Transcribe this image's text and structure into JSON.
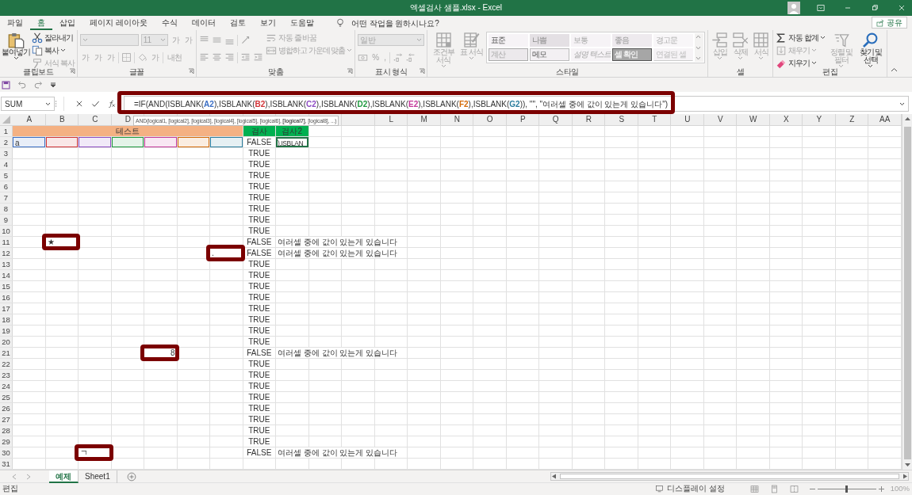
{
  "window": {
    "title": "엑셀검사 샘플.xlsx - Excel"
  },
  "menu_tabs": [
    {
      "label": "파일",
      "selected": false
    },
    {
      "label": "홈",
      "selected": true
    },
    {
      "label": "삽입",
      "selected": false
    },
    {
      "label": "페이지 레이아웃",
      "selected": false
    },
    {
      "label": "수식",
      "selected": false
    },
    {
      "label": "데이터",
      "selected": false
    },
    {
      "label": "검토",
      "selected": false
    },
    {
      "label": "보기",
      "selected": false
    },
    {
      "label": "도움말",
      "selected": false
    }
  ],
  "tell_me": {
    "label": "어떤 작업을 원하시나요?"
  },
  "share_button": {
    "label": "공유"
  },
  "ribbon_groups": [
    {
      "label": "클립보드",
      "launcher": true,
      "columns": [
        [
          {
            "kind": "large",
            "label": "붙여넣기",
            "dropdown": true,
            "disabled": false
          }
        ],
        [
          {
            "kind": "small",
            "label": "잘라내기",
            "dropdown": false,
            "disabled": false
          },
          {
            "kind": "small",
            "label": "복사",
            "dropdown": true,
            "disabled": false
          },
          {
            "kind": "small",
            "label": "서식 복사",
            "dropdown": false,
            "disabled": true
          }
        ]
      ]
    },
    {
      "label": "글꼴",
      "launcher": true,
      "columns": [
        [
          {
            "kind": "row",
            "parts": [
              {
                "kind": "combo",
                "disabled": true
              },
              {
                "kind": "combo",
                "value": "11",
                "disabled": true
              },
              {
                "kind": "glyph",
                "text": "가",
                "disabled": true
              },
              {
                "kind": "glyph",
                "text": "가",
                "disabled": true
              }
            ]
          },
          {
            "kind": "row",
            "parts": [
              {
                "kind": "glyph",
                "text": "가",
                "disabled": true
              },
              {
                "kind": "glyph",
                "text": "가",
                "disabled": true
              },
              {
                "kind": "glyph",
                "text": "가",
                "disabled": true
              },
              {
                "kind": "sep"
              },
              {
                "kind": "icon",
                "disabled": true
              },
              {
                "kind": "sep"
              },
              {
                "kind": "icon",
                "disabled": true
              },
              {
                "kind": "glyph",
                "text": "가",
                "disabled": true
              },
              {
                "kind": "sep"
              },
              {
                "kind": "glyph",
                "text": "내천",
                "disabled": true
              }
            ]
          }
        ]
      ]
    },
    {
      "label": "맞춤",
      "launcher": true,
      "columns": [
        [
          {
            "kind": "row",
            "parts": [
              {
                "kind": "icon",
                "disabled": true
              },
              {
                "kind": "icon",
                "disabled": true
              },
              {
                "kind": "icon",
                "disabled": true
              },
              {
                "kind": "sep"
              },
              {
                "kind": "icon",
                "disabled": true
              }
            ]
          },
          {
            "kind": "row",
            "parts": [
              {
                "kind": "icon",
                "disabled": true
              },
              {
                "kind": "icon",
                "disabled": true
              },
              {
                "kind": "icon",
                "disabled": true
              },
              {
                "kind": "sep"
              },
              {
                "kind": "icon",
                "disabled": true
              },
              {
                "kind": "icon",
                "disabled": true
              }
            ]
          }
        ],
        [
          {
            "kind": "small",
            "label": "자동 줄 바꿈",
            "dropdown": false,
            "disabled": true
          },
          {
            "kind": "small",
            "label": "병합하고 가운데 맞춤",
            "dropdown": true,
            "disabled": true
          }
        ]
      ]
    },
    {
      "label": "표시 형식",
      "launcher": true,
      "columns": [
        [
          {
            "kind": "row",
            "parts": [
              {
                "kind": "combo",
                "value": "일반",
                "disabled": true
              }
            ]
          },
          {
            "kind": "row",
            "parts": [
              {
                "kind": "icon",
                "disabled": true
              },
              {
                "kind": "glyph",
                "text": "%",
                "disabled": true
              },
              {
                "kind": "glyph",
                "text": ",",
                "disabled": true
              },
              {
                "kind": "sep"
              },
              {
                "kind": "icon",
                "disabled": true
              },
              {
                "kind": "icon",
                "disabled": true
              }
            ]
          }
        ]
      ]
    },
    {
      "label": "스타일",
      "launcher": false,
      "columns": [
        [
          {
            "kind": "large",
            "label": "조건부 서식",
            "dropdown": true,
            "disabled": true
          }
        ],
        [
          {
            "kind": "large",
            "label": "표 서식",
            "dropdown": true,
            "disabled": true
          }
        ],
        [
          {
            "kind": "gallery",
            "styles": [
              {
                "label": "표준",
                "kind": "normal"
              },
              {
                "label": "나쁨",
                "kind": "bad"
              },
              {
                "label": "보통",
                "kind": "neutral"
              },
              {
                "label": "좋음",
                "kind": "good"
              },
              {
                "label": "경고문",
                "kind": "warning"
              },
              {
                "label": "계산",
                "kind": "calculation"
              },
              {
                "label": "메모",
                "kind": "note"
              },
              {
                "label": "설명 텍스트",
                "kind": "explanatory"
              },
              {
                "label": "셀 확인",
                "kind": "check"
              },
              {
                "label": "연결된 셀",
                "kind": "linked"
              }
            ]
          }
        ]
      ]
    },
    {
      "label": "셀",
      "launcher": false,
      "columns": [
        [
          {
            "kind": "large",
            "label": "삽입",
            "dropdown": true,
            "disabled": true
          }
        ],
        [
          {
            "kind": "large",
            "label": "삭제",
            "dropdown": true,
            "disabled": true
          }
        ],
        [
          {
            "kind": "large",
            "label": "서식",
            "dropdown": true,
            "disabled": true
          }
        ]
      ]
    },
    {
      "label": "편집",
      "launcher": false,
      "columns": [
        [
          {
            "kind": "small",
            "label": "자동 합계",
            "dropdown": true,
            "disabled": false
          },
          {
            "kind": "small",
            "label": "채우기",
            "dropdown": true,
            "disabled": true
          },
          {
            "kind": "small",
            "label": "지우기",
            "dropdown": true,
            "disabled": false
          }
        ],
        [
          {
            "kind": "large",
            "label": "정렬 및 필터",
            "dropdown": true,
            "disabled": true
          }
        ],
        [
          {
            "kind": "large",
            "label": "찾기 및 선택",
            "dropdown": true,
            "disabled": false
          }
        ]
      ]
    }
  ],
  "name_box": {
    "value": "SUM"
  },
  "formula": {
    "highlighted": true,
    "segments": [
      {
        "text": "=IF(AND(ISBLANK("
      },
      {
        "text": "A2",
        "color": "#3c6fc4"
      },
      {
        "text": "),ISBLANK("
      },
      {
        "text": "B2",
        "color": "#d13438"
      },
      {
        "text": "),ISBLANK("
      },
      {
        "text": "C2",
        "color": "#8e4dc3"
      },
      {
        "text": "),ISBLANK("
      },
      {
        "text": "D2",
        "color": "#1f9a3f"
      },
      {
        "text": "),ISBLANK("
      },
      {
        "text": "E2",
        "color": "#c4399a"
      },
      {
        "text": "),ISBLANK("
      },
      {
        "text": "F2",
        "color": "#d46b08"
      },
      {
        "text": "),ISBLANK("
      },
      {
        "text": "G2",
        "color": "#2c7e9e"
      },
      {
        "text": ")), \"\", \"여러셀 중에 값이 있는게 있습니다\")"
      }
    ]
  },
  "tooltip": {
    "text": "AND(logical1, [logical2], [logical3], [logical4], [logical5], [logical6], **[logical7]**, [logical8], ...)"
  },
  "columns": [
    "A",
    "B",
    "C",
    "D",
    null,
    null,
    null,
    null,
    null,
    null,
    null,
    "L",
    "M",
    "N",
    "O",
    "P",
    "Q",
    "R",
    "S",
    "T",
    "U",
    "V",
    "W",
    "X",
    "Y",
    "Z",
    "AA"
  ],
  "rows": [
    {
      "header": "1",
      "cells": [
        {
          "kind": "header",
          "text": "테스트",
          "color": "#f4b183",
          "merged": true
        },
        null,
        null,
        null,
        null,
        null,
        null,
        {
          "kind": "header",
          "text": "검사",
          "color": "#00b050"
        },
        {
          "kind": "header",
          "text": "검사2",
          "color": "#00b050"
        }
      ]
    },
    {
      "header": "2",
      "cells": [
        {
          "kind": "text",
          "text": "a",
          "color": "#3c6fc4"
        },
        {
          "kind": "text",
          "color": "#d13438"
        },
        {
          "kind": "text",
          "color": "#8e4dc3"
        },
        {
          "kind": "text",
          "color": "#1f9a3f"
        },
        {
          "kind": "text",
          "color": "#c4399a"
        },
        {
          "kind": "text",
          "color": "#d46b08"
        },
        {
          "kind": "text",
          "color": "#2c7e9e"
        },
        {
          "kind": "boolean",
          "text": "FALSE"
        },
        {
          "kind": "text",
          "text": "),ISBLAN",
          "active": true
        }
      ]
    },
    {
      "header": "3",
      "cells": [
        null,
        null,
        null,
        null,
        null,
        null,
        null,
        {
          "kind": "boolean",
          "text": "TRUE"
        }
      ]
    },
    {
      "header": "4",
      "cells": [
        null,
        null,
        null,
        null,
        null,
        null,
        null,
        {
          "kind": "boolean",
          "text": "TRUE"
        }
      ]
    },
    {
      "header": "5",
      "cells": [
        null,
        null,
        null,
        null,
        null,
        null,
        null,
        {
          "kind": "boolean",
          "text": "TRUE"
        }
      ]
    },
    {
      "header": "6",
      "cells": [
        null,
        null,
        null,
        null,
        null,
        null,
        null,
        {
          "kind": "boolean",
          "text": "TRUE"
        }
      ]
    },
    {
      "header": "7",
      "cells": [
        null,
        null,
        null,
        null,
        null,
        null,
        null,
        {
          "kind": "boolean",
          "text": "TRUE"
        }
      ]
    },
    {
      "header": "8",
      "cells": [
        null,
        null,
        null,
        null,
        null,
        null,
        null,
        {
          "kind": "boolean",
          "text": "TRUE"
        }
      ]
    },
    {
      "header": "9",
      "cells": [
        null,
        null,
        null,
        null,
        null,
        null,
        null,
        {
          "kind": "boolean",
          "text": "TRUE"
        }
      ]
    },
    {
      "header": "10",
      "cells": [
        null,
        null,
        null,
        null,
        null,
        null,
        null,
        {
          "kind": "boolean",
          "text": "TRUE"
        }
      ]
    },
    {
      "header": "11",
      "cells": [
        null,
        {
          "kind": "text",
          "text": "★",
          "highlighted": true
        },
        null,
        null,
        null,
        null,
        null,
        {
          "kind": "boolean",
          "text": "FALSE"
        },
        {
          "kind": "text",
          "text": "여러셀 중에 값이 있는게 있습니다"
        }
      ]
    },
    {
      "header": "12",
      "cells": [
        null,
        null,
        null,
        null,
        null,
        null,
        {
          "kind": "text",
          "text": ".",
          "highlighted": true
        },
        {
          "kind": "boolean",
          "text": "FALSE"
        },
        {
          "kind": "text",
          "text": "여러셀 중에 값이 있는게 있습니다"
        }
      ]
    },
    {
      "header": "13",
      "cells": [
        null,
        null,
        null,
        null,
        null,
        null,
        null,
        {
          "kind": "boolean",
          "text": "TRUE"
        }
      ]
    },
    {
      "header": "14",
      "cells": [
        null,
        null,
        null,
        null,
        null,
        null,
        null,
        {
          "kind": "boolean",
          "text": "TRUE"
        }
      ]
    },
    {
      "header": "15",
      "cells": [
        null,
        null,
        null,
        null,
        null,
        null,
        null,
        {
          "kind": "boolean",
          "text": "TRUE"
        }
      ]
    },
    {
      "header": "16",
      "cells": [
        null,
        null,
        null,
        null,
        null,
        null,
        null,
        {
          "kind": "boolean",
          "text": "TRUE"
        }
      ]
    },
    {
      "header": "17",
      "cells": [
        null,
        null,
        null,
        null,
        null,
        null,
        null,
        {
          "kind": "boolean",
          "text": "TRUE"
        }
      ]
    },
    {
      "header": "18",
      "cells": [
        null,
        null,
        null,
        null,
        null,
        null,
        null,
        {
          "kind": "boolean",
          "text": "TRUE"
        }
      ]
    },
    {
      "header": "19",
      "cells": [
        null,
        null,
        null,
        null,
        null,
        null,
        null,
        {
          "kind": "boolean",
          "text": "TRUE"
        }
      ]
    },
    {
      "header": "20",
      "cells": [
        null,
        null,
        null,
        null,
        null,
        null,
        null,
        {
          "kind": "boolean",
          "text": "TRUE"
        }
      ]
    },
    {
      "header": "21",
      "cells": [
        null,
        null,
        null,
        null,
        {
          "kind": "number",
          "text": "8",
          "highlighted": true
        },
        null,
        null,
        {
          "kind": "boolean",
          "text": "FALSE"
        },
        {
          "kind": "text",
          "text": "여러셀 중에 값이 있는게 있습니다"
        }
      ]
    },
    {
      "header": "22",
      "cells": [
        null,
        null,
        null,
        null,
        null,
        null,
        null,
        {
          "kind": "boolean",
          "text": "TRUE"
        }
      ]
    },
    {
      "header": "23",
      "cells": [
        null,
        null,
        null,
        null,
        null,
        null,
        null,
        {
          "kind": "boolean",
          "text": "TRUE"
        }
      ]
    },
    {
      "header": "24",
      "cells": [
        null,
        null,
        null,
        null,
        null,
        null,
        null,
        {
          "kind": "boolean",
          "text": "TRUE"
        }
      ]
    },
    {
      "header": "25",
      "cells": [
        null,
        null,
        null,
        null,
        null,
        null,
        null,
        {
          "kind": "boolean",
          "text": "TRUE"
        }
      ]
    },
    {
      "header": "26",
      "cells": [
        null,
        null,
        null,
        null,
        null,
        null,
        null,
        {
          "kind": "boolean",
          "text": "TRUE"
        }
      ]
    },
    {
      "header": "27",
      "cells": [
        null,
        null,
        null,
        null,
        null,
        null,
        null,
        {
          "kind": "boolean",
          "text": "TRUE"
        }
      ]
    },
    {
      "header": "28",
      "cells": [
        null,
        null,
        null,
        null,
        null,
        null,
        null,
        {
          "kind": "boolean",
          "text": "TRUE"
        }
      ]
    },
    {
      "header": "29",
      "cells": [
        null,
        null,
        null,
        null,
        null,
        null,
        null,
        {
          "kind": "boolean",
          "text": "TRUE"
        }
      ]
    },
    {
      "header": "30",
      "cells": [
        null,
        null,
        {
          "kind": "text",
          "text": "ㄱ",
          "highlighted": true
        },
        null,
        null,
        null,
        null,
        {
          "kind": "boolean",
          "text": "FALSE"
        },
        {
          "kind": "text",
          "text": "여러셀 중에 값이 있는게 있습니다"
        }
      ]
    },
    {
      "header": "31",
      "cells": []
    }
  ],
  "sheet_tabs": [
    {
      "label": "예제",
      "selected": true
    },
    {
      "label": "Sheet1",
      "selected": false
    }
  ],
  "status_bar": {
    "mode": "편집",
    "display_settings": "디스플레이 설정",
    "zoom": {
      "level": 0.5,
      "reading": "100%"
    }
  }
}
